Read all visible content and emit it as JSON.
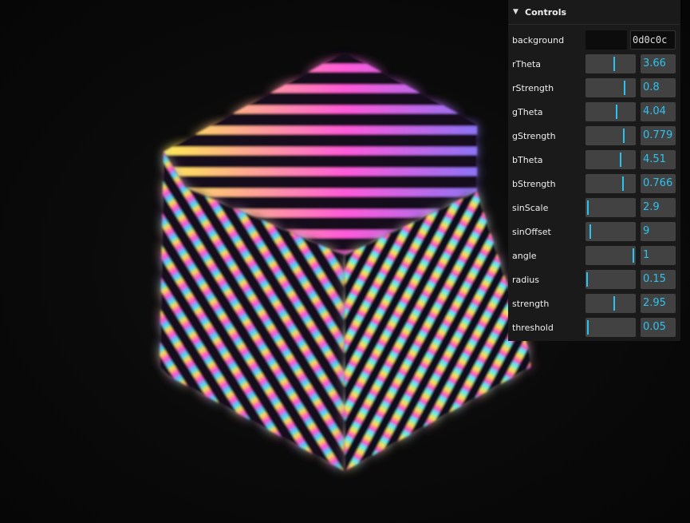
{
  "panel": {
    "title": "Controls",
    "background": {
      "label": "background",
      "hex": "0d0c0c",
      "color": "#0d0c0c"
    },
    "controls": [
      {
        "label": "rTheta",
        "value": "3.66",
        "fraction": 0.58
      },
      {
        "label": "rStrength",
        "value": "0.8",
        "fraction": 0.8
      },
      {
        "label": "gTheta",
        "value": "4.04",
        "fraction": 0.64
      },
      {
        "label": "gStrength",
        "value": "0.779",
        "fraction": 0.78
      },
      {
        "label": "bTheta",
        "value": "4.51",
        "fraction": 0.72
      },
      {
        "label": "bStrength",
        "value": "0.766",
        "fraction": 0.77
      },
      {
        "label": "sinScale",
        "value": "2.9",
        "fraction": 0.03
      },
      {
        "label": "sinOffset",
        "value": "9",
        "fraction": 0.09
      },
      {
        "label": "angle",
        "value": "1",
        "fraction": 0.98
      },
      {
        "label": "radius",
        "value": "0.15",
        "fraction": 0.02
      },
      {
        "label": "strength",
        "value": "2.95",
        "fraction": 0.59
      },
      {
        "label": "threshold",
        "value": "0.05",
        "fraction": 0.03
      }
    ]
  },
  "colors": {
    "accent": "#2cc3f0",
    "panel_bg": "#1a1a1a",
    "control_bg": "#424242",
    "scene_bg": "#0d0c0c"
  }
}
